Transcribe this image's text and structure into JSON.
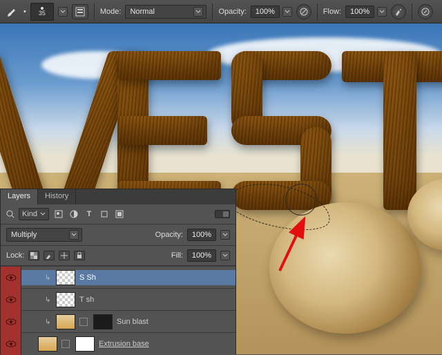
{
  "toolbar": {
    "brush_size": "35",
    "mode_label": "Mode:",
    "mode_value": "Normal",
    "opacity_label": "Opacity:",
    "opacity_value": "100%",
    "flow_label": "Flow:",
    "flow_value": "100%"
  },
  "panel": {
    "tabs": {
      "layers": "Layers",
      "history": "History"
    },
    "filter_kind": "Kind",
    "blend_mode": "Multiply",
    "opacity_label": "Opacity:",
    "opacity_value": "100%",
    "lock_label": "Lock:",
    "fill_label": "Fill:",
    "fill_value": "100%",
    "layers": [
      {
        "name": "S Sh",
        "clipped": true,
        "selected": true,
        "thumbs": [
          "checker"
        ]
      },
      {
        "name": "T sh",
        "clipped": true,
        "selected": false,
        "thumbs": [
          "checker"
        ]
      },
      {
        "name": "Sun blast",
        "clipped": true,
        "selected": false,
        "thumbs": [
          "orange",
          "dark"
        ]
      },
      {
        "name": "Extrusion base",
        "clipped": false,
        "selected": false,
        "underline": true,
        "thumbs": [
          "orange",
          "white"
        ]
      }
    ]
  },
  "icons": {
    "brush": "brush-tool-icon",
    "pressure_size": "pressure-size-icon",
    "pressure_opacity": "pressure-opacity-icon",
    "airbrush": "airbrush-icon",
    "tablet": "tablet-pressure-icon"
  }
}
